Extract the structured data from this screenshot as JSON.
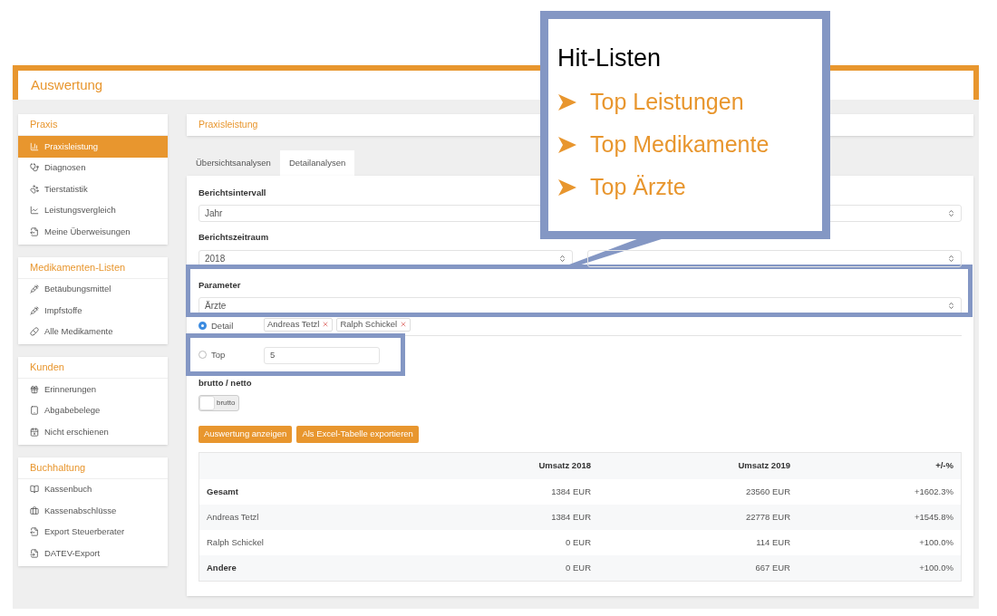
{
  "header": {
    "title": "Auswertung"
  },
  "sidebar": [
    {
      "title": "Praxis",
      "items": [
        {
          "label": "Praxisleistung",
          "selected": true
        },
        {
          "label": "Diagnosen",
          "selected": false
        },
        {
          "label": "Tierstatistik",
          "selected": false
        },
        {
          "label": "Leistungsvergleich",
          "selected": false
        },
        {
          "label": "Meine Überweisungen",
          "selected": false
        }
      ]
    },
    {
      "title": "Medikamenten-Listen",
      "items": [
        {
          "label": "Betäubungsmittel",
          "selected": false
        },
        {
          "label": "Impfstoffe",
          "selected": false
        },
        {
          "label": "Alle Medikamente",
          "selected": false
        }
      ]
    },
    {
      "title": "Kunden",
      "items": [
        {
          "label": "Erinnerungen",
          "selected": false
        },
        {
          "label": "Abgabebelege",
          "selected": false
        },
        {
          "label": "Nicht erschienen",
          "selected": false
        }
      ]
    },
    {
      "title": "Buchhaltung",
      "items": [
        {
          "label": "Kassenbuch",
          "selected": false
        },
        {
          "label": "Kassenabschlüsse",
          "selected": false
        },
        {
          "label": "Export Steuerberater",
          "selected": false
        },
        {
          "label": "DATEV-Export",
          "selected": false
        }
      ]
    }
  ],
  "page_title": "Praxisleistung",
  "tabs": [
    {
      "label": "Übersichtsanalysen",
      "selected": false
    },
    {
      "label": "Detailanalysen",
      "selected": true
    }
  ],
  "form": {
    "interval": {
      "label": "Berichtsintervall",
      "value": "Jahr"
    },
    "period": {
      "label": "Berichtszeitraum",
      "value": "2018"
    },
    "parameter": {
      "label": "Parameter",
      "value": "Ärzte"
    },
    "modes": [
      {
        "label": "Detail",
        "selected": true,
        "kind": "tags",
        "tags": [
          "Andreas Tetzl",
          "Ralph Schickel"
        ]
      },
      {
        "label": "Top",
        "selected": false,
        "kind": "number",
        "value": "5"
      }
    ],
    "toggle": {
      "label": "brutto / netto",
      "text": "brutto",
      "on": false
    },
    "buttons": [
      "Auswertung anzeigen",
      "Als Excel-Tabelle exportieren"
    ]
  },
  "table": {
    "columns": [
      "",
      "Umsatz 2018",
      "Umsatz 2019",
      "+/-%"
    ],
    "rows": [
      {
        "kind": "total",
        "cells": [
          "Gesamt",
          "1384 EUR",
          "23560 EUR",
          "+1602.3%"
        ]
      },
      {
        "kind": "item",
        "cells": [
          "Andreas Tetzl",
          "1384 EUR",
          "22778 EUR",
          "+1545.8%"
        ]
      },
      {
        "kind": "item",
        "cells": [
          "Ralph Schickel",
          "0 EUR",
          "114 EUR",
          "+100.0%"
        ]
      },
      {
        "kind": "total",
        "cells": [
          "Andere",
          "0 EUR",
          "667 EUR",
          "+100.0%"
        ]
      }
    ]
  },
  "callout": {
    "title": "Hit-Listen",
    "items": [
      "Top Leistungen",
      "Top Medikamente",
      "Top Ärzte"
    ]
  }
}
